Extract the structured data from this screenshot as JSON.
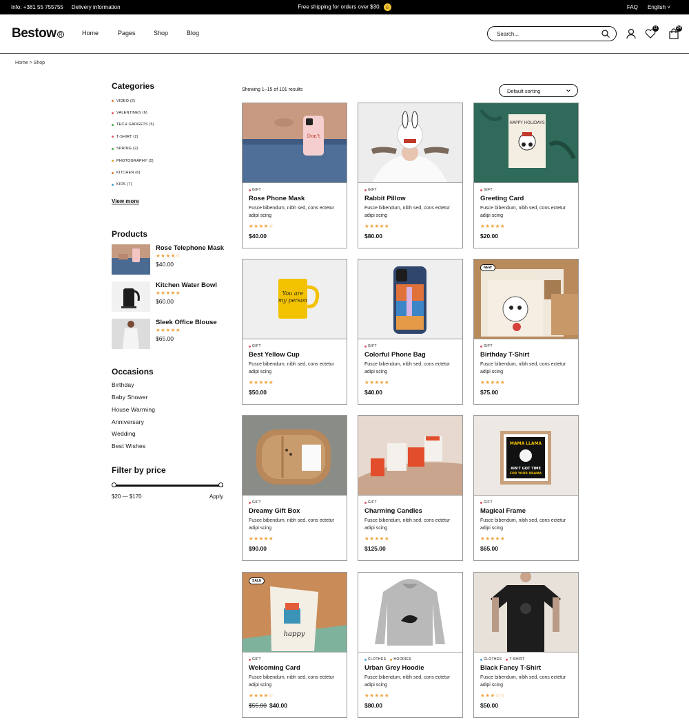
{
  "topbar": {
    "info": "Info: +381 55 755755",
    "delivery": "Delivery information",
    "promo": "Free shipping for orders over $30.",
    "faq": "FAQ",
    "language": "English ˅"
  },
  "header": {
    "logo": "Bestow",
    "nav": [
      "Home",
      "Pages",
      "Shop",
      "Blog"
    ],
    "search_placeholder": "Search...",
    "wishlist_count": "11",
    "cart_count": "24"
  },
  "breadcrumb": "Home > Shop",
  "sidebar": {
    "categories_title": "Categories",
    "categories": [
      {
        "label": "VIDEO (2)",
        "color": "#e07b39"
      },
      {
        "label": "VALENTINES (6)",
        "color": "#e0566b"
      },
      {
        "label": "TECH GADGETS (5)",
        "color": "#4cae4f"
      },
      {
        "label": "T-SHIRT (2)",
        "color": "#e0566b"
      },
      {
        "label": "SPRING (2)",
        "color": "#4cae4f"
      },
      {
        "label": "PHOTOGRAPHY (2)",
        "color": "#e0a030"
      },
      {
        "label": "KITCHEN (6)",
        "color": "#e07b39"
      },
      {
        "label": "KIDS (7)",
        "color": "#4aa3d9"
      }
    ],
    "view_more": "View more",
    "products_title": "Products",
    "products": [
      {
        "name": "Rose Telephone Mask",
        "stars": "★★★★☆",
        "price": "$40.00"
      },
      {
        "name": "Kitchen Water Bowl",
        "stars": "★★★★★",
        "price": "$60.00"
      },
      {
        "name": "Sleek Office Blouse",
        "stars": "★★★★★",
        "price": "$65.00"
      }
    ],
    "occasions_title": "Occasions",
    "occasions": [
      "Birthday",
      "Baby Shower",
      "House Warming",
      "Anniversary",
      "Wedding",
      "Best Wishes"
    ],
    "filter_title": "Filter by price",
    "price_range": "$20 — $170",
    "apply": "Apply"
  },
  "shop": {
    "showing": "Showing 1–15 of 101 results",
    "sort": "Default sorting",
    "products": [
      {
        "tags": [
          {
            "label": "GIFT",
            "color": "#e0566b"
          }
        ],
        "title": "Rose Phone Mask",
        "desc": "Fusce bibendum, nibh sed, cons ectetur adipi scing",
        "stars": "★★★★☆",
        "price": "$40.00",
        "flag": "",
        "old_price": ""
      },
      {
        "tags": [
          {
            "label": "GIFT",
            "color": "#e0566b"
          }
        ],
        "title": "Rabbit Pillow",
        "desc": "Fusce bibendum, nibh sed, cons ectetur adipi scing",
        "stars": "★★★★★",
        "price": "$80.00",
        "flag": "",
        "old_price": ""
      },
      {
        "tags": [
          {
            "label": "GIFT",
            "color": "#e0566b"
          }
        ],
        "title": "Greeting Card",
        "desc": "Fusce bibendum, nibh sed, cons ectetur adipi scing",
        "stars": "★★★★★",
        "price": "$20.00",
        "flag": "",
        "old_price": ""
      },
      {
        "tags": [
          {
            "label": "GIFT",
            "color": "#e0566b"
          }
        ],
        "title": "Best Yellow Cup",
        "desc": "Fusce bibendum, nibh sed, cons ectetur adipi scing",
        "stars": "★★★★★",
        "price": "$50.00",
        "flag": "",
        "old_price": ""
      },
      {
        "tags": [
          {
            "label": "GIFT",
            "color": "#e0566b"
          }
        ],
        "title": "Colorful Phone Bag",
        "desc": "Fusce bibendum, nibh sed, cons ectetur adipi scing",
        "stars": "★★★★★",
        "price": "$40.00",
        "flag": "",
        "old_price": ""
      },
      {
        "tags": [
          {
            "label": "GIFT",
            "color": "#e0566b"
          }
        ],
        "title": "Birthday T-Shirt",
        "desc": "Fusce bibendum, nibh sed, cons ectetur adipi scing",
        "stars": "★★★★★",
        "price": "$75.00",
        "flag": "NEW",
        "old_price": ""
      },
      {
        "tags": [
          {
            "label": "GIFT",
            "color": "#e0566b"
          }
        ],
        "title": "Dreamy Gift Box",
        "desc": "Fusce bibendum, nibh sed, cons ectetur adipi scing",
        "stars": "★★★★★",
        "price": "$90.00",
        "flag": "",
        "old_price": ""
      },
      {
        "tags": [
          {
            "label": "GIFT",
            "color": "#e0566b"
          }
        ],
        "title": "Charming Candles",
        "desc": "Fusce bibendum, nibh sed, cons ectetur adipi scing",
        "stars": "★★★★★",
        "price": "$125.00",
        "flag": "",
        "old_price": ""
      },
      {
        "tags": [
          {
            "label": "GIFT",
            "color": "#e0566b"
          }
        ],
        "title": "Magical Frame",
        "desc": "Fusce bibendum, nibh sed, cons ectetur adipi scing",
        "stars": "★★★★★",
        "price": "$65.00",
        "flag": "",
        "old_price": ""
      },
      {
        "tags": [
          {
            "label": "GIFT",
            "color": "#e0566b"
          }
        ],
        "title": "Welcoming Card",
        "desc": "Fusce bibendum, nibh sed, cons ectetur adipi scing",
        "stars": "★★★★☆",
        "price": "$40.00",
        "flag": "SALE",
        "old_price": "$55.00"
      },
      {
        "tags": [
          {
            "label": "CLOTHES",
            "color": "#4aa3d9"
          },
          {
            "label": "HOODIES",
            "color": "#e0a030"
          }
        ],
        "title": "Urban Grey Hoodie",
        "desc": "Fusce bibendum, nibh sed, cons ectetur adipi scing",
        "stars": "★★★★★",
        "price": "$80.00",
        "flag": "",
        "old_price": ""
      },
      {
        "tags": [
          {
            "label": "CLOTHES",
            "color": "#4aa3d9"
          },
          {
            "label": "T-SHIRT",
            "color": "#e0566b"
          }
        ],
        "title": "Black Fancy T-Shirt",
        "desc": "Fusce bibendum, nibh sed, cons ectetur adipi scing",
        "stars": "★★★☆☆",
        "price": "$50.00",
        "flag": "",
        "old_price": ""
      }
    ]
  }
}
